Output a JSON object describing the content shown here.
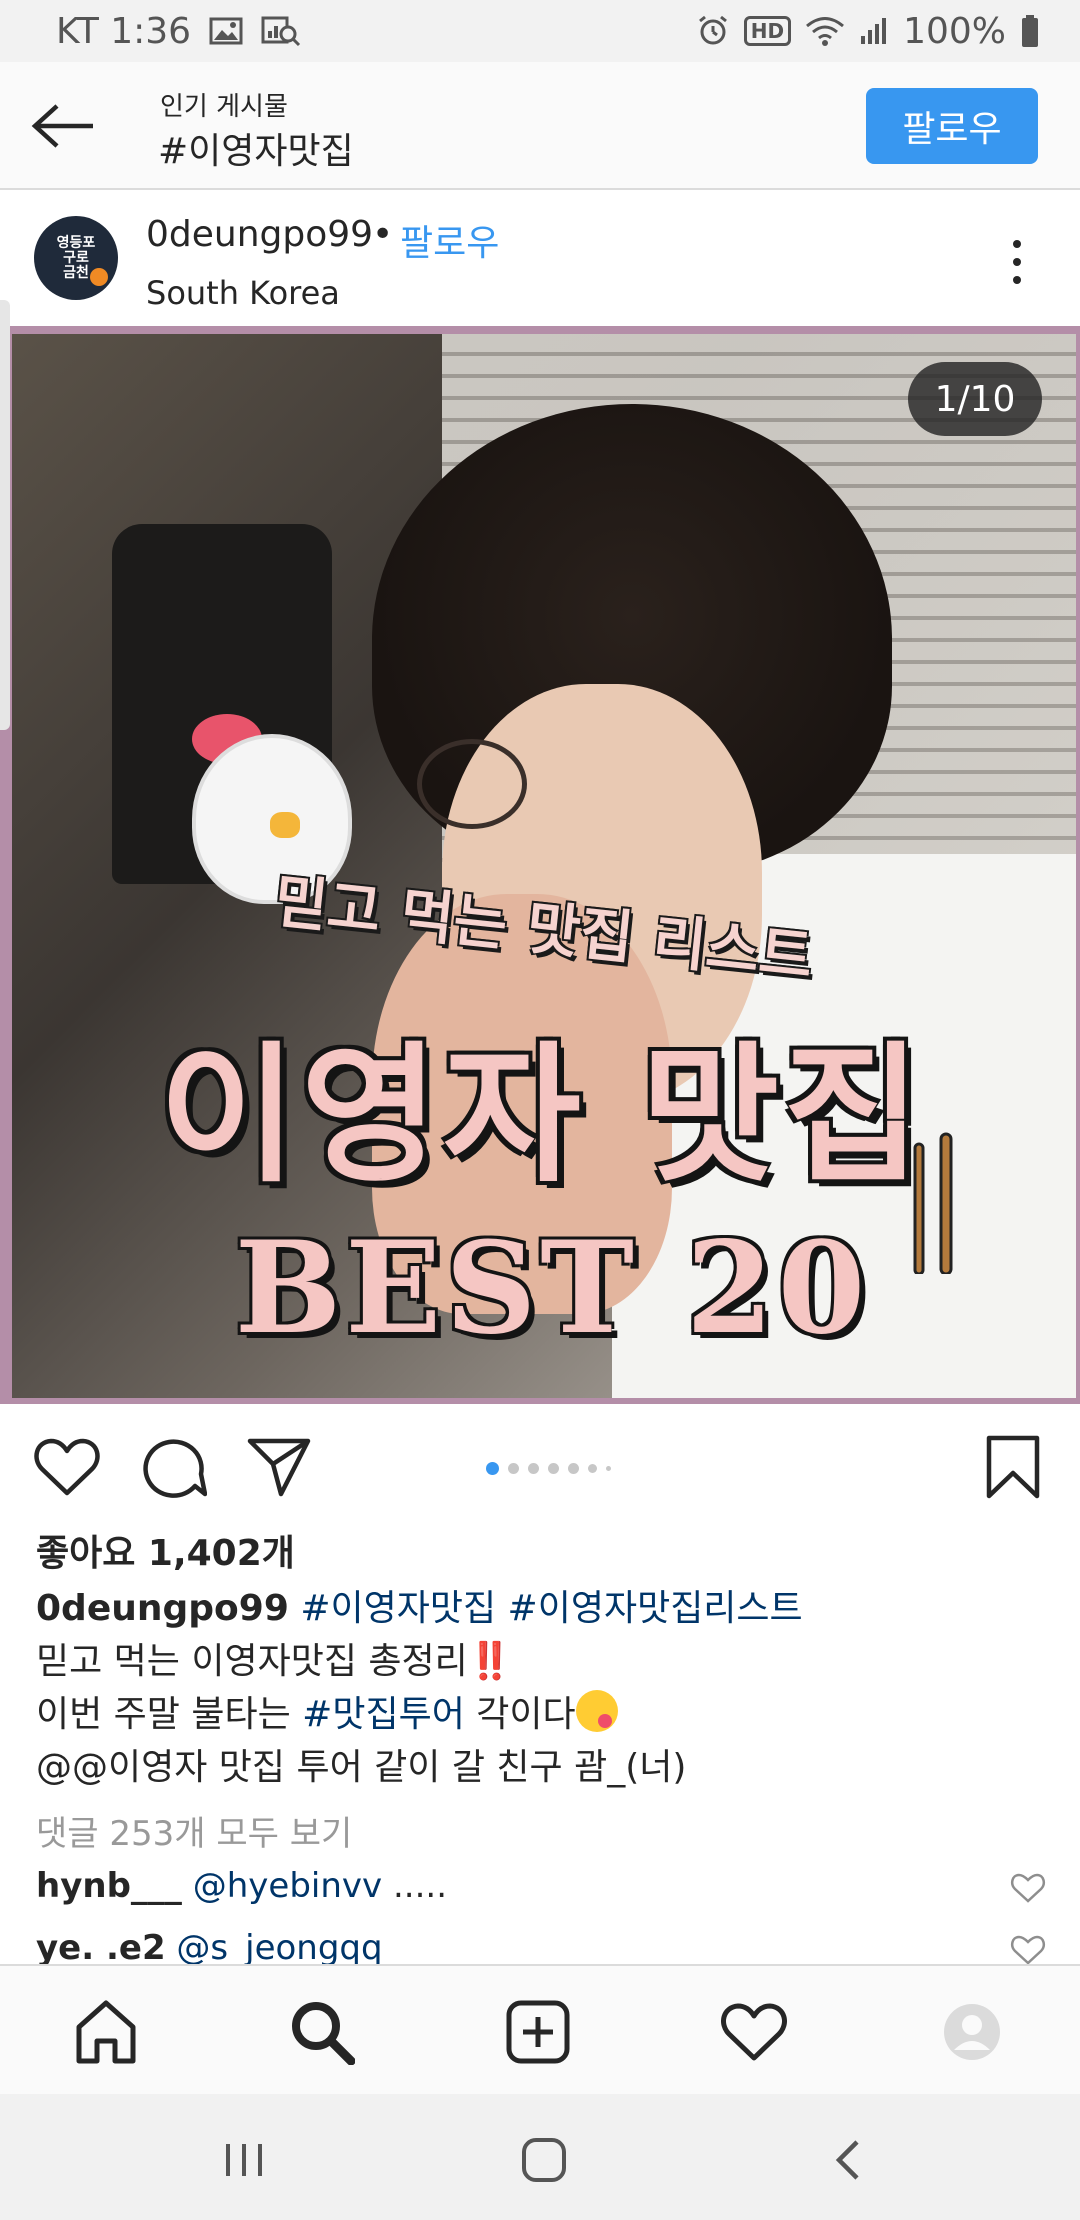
{
  "status_bar": {
    "carrier_time": "KT 1:36",
    "battery": "100%",
    "hd_label": "HD"
  },
  "header": {
    "subtitle": "인기 게시물",
    "title": "#이영자맛집",
    "follow_label": "팔로우"
  },
  "post": {
    "avatar_text_1": "영등포",
    "avatar_text_2": "구로",
    "avatar_text_3": "금천",
    "username": "0deungpo99",
    "separator": "•",
    "follow_label": "팔로우",
    "location": "South Korea",
    "image": {
      "counter": "1/10",
      "subtitle": "믿고 먹는 맛집 리스트",
      "title": "이영자 맛집",
      "best": "BEST 20"
    },
    "carousel": {
      "total": 10,
      "current": 1
    },
    "likes": "좋아요 1,402개",
    "caption": {
      "username": "0deungpo99",
      "tag1": "#이영자맛집",
      "tag2": "#이영자맛집리스트",
      "line2": "믿고 먹는 이영자맛집 총정리",
      "line2_mark": "‼️",
      "line3_pre": "이번 주말 불타는 ",
      "line3_tag": "#맛집투어",
      "line3_post": " 각이다",
      "line4": "@@이영자 맛집 투어 같이 갈 친구 괌_(너)"
    },
    "view_comments": "댓글 253개 모두 보기",
    "comments": [
      {
        "user": "hynb___",
        "mention": "@hyebinvv",
        "text": " ....."
      },
      {
        "user": "ye.       .e2",
        "mention": "@s_jeongqq",
        "text": ""
      }
    ]
  },
  "colors": {
    "accent": "#3897f0",
    "hashtag": "#003569",
    "muted": "#999999"
  },
  "bottom_nav": {
    "items": [
      "home-icon",
      "search-icon",
      "add-icon",
      "heart-icon",
      "profile-icon"
    ]
  }
}
